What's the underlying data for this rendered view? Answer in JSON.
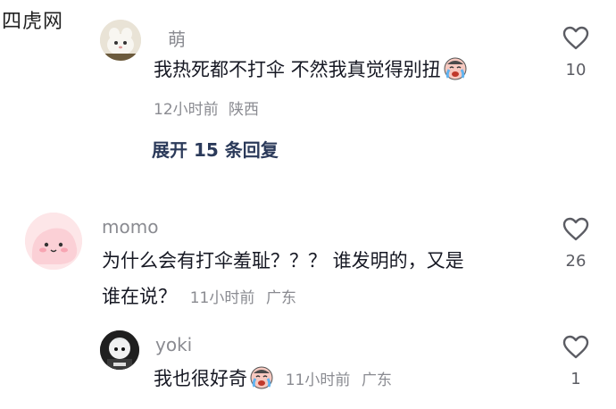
{
  "watermark": "四虎网",
  "comments": [
    {
      "username": "萌",
      "text": "我热死都不打伞  不然我真觉得别扭",
      "emoji": "crying-face-icon",
      "time": "12小时前",
      "location": "陕西",
      "expand_label": "展开 15 条回复",
      "likes": "10"
    },
    {
      "username": "momo",
      "text_line1": "为什么会有打伞羞耻？？？ 谁发明的，又是",
      "text_line2": "谁在说？",
      "time": "11小时前",
      "location": "广东",
      "likes": "26"
    },
    {
      "username": "yoki",
      "text": "我也很好奇",
      "emoji": "crying-face-icon",
      "time": "11小时前",
      "location": "广东",
      "likes": "1"
    }
  ]
}
